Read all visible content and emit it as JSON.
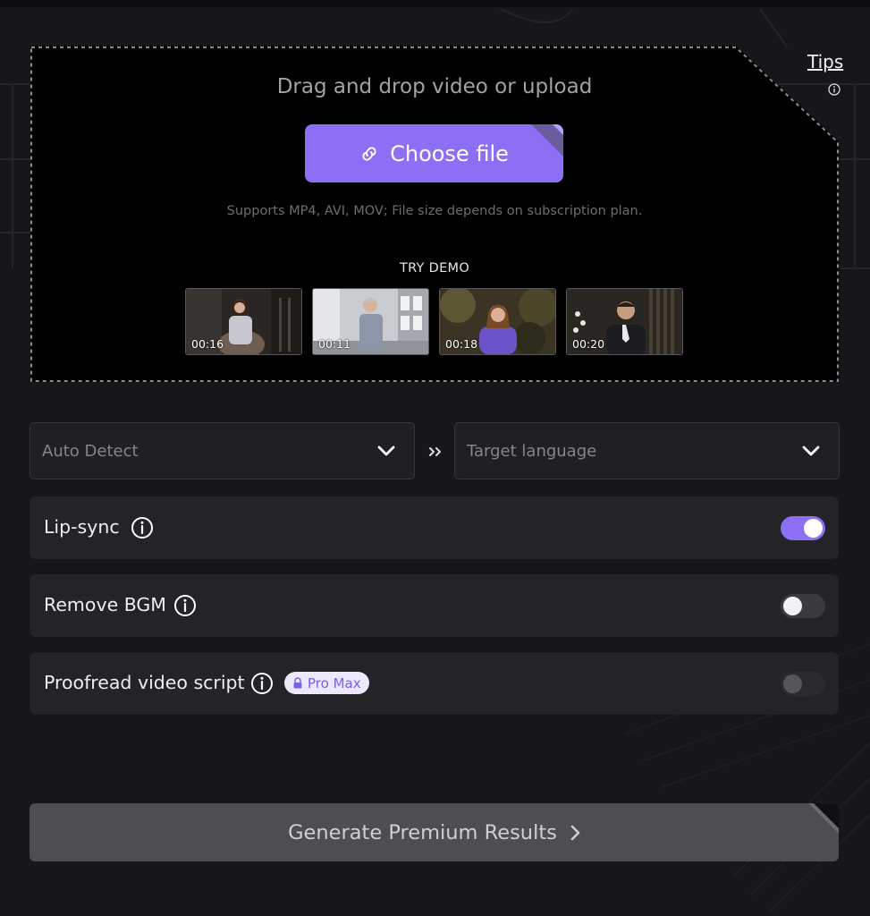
{
  "upload": {
    "tips_label": "Tips",
    "title": "Drag and drop video or upload",
    "choose_file_label": "Choose file",
    "supports_text": "Supports MP4, AVI, MOV; File size depends on subscription plan.",
    "try_demo_label": "TRY DEMO",
    "demos": [
      {
        "duration": "00:16"
      },
      {
        "duration": "00:11"
      },
      {
        "duration": "00:18"
      },
      {
        "duration": "00:20"
      }
    ]
  },
  "languages": {
    "source_placeholder": "Auto Detect",
    "target_placeholder": "Target language"
  },
  "options": [
    {
      "label": "Lip-sync",
      "enabled": true
    },
    {
      "label": "Remove BGM",
      "enabled": false
    },
    {
      "label": "Proofread video script",
      "enabled": false,
      "badge": "Pro Max"
    }
  ],
  "generate_label": "Generate Premium Results",
  "colors": {
    "accent": "#8c6ff4",
    "background": "#16161b",
    "panel": "#232328",
    "badge_bg": "#ece8fd",
    "badge_text": "#7d5cf0"
  }
}
